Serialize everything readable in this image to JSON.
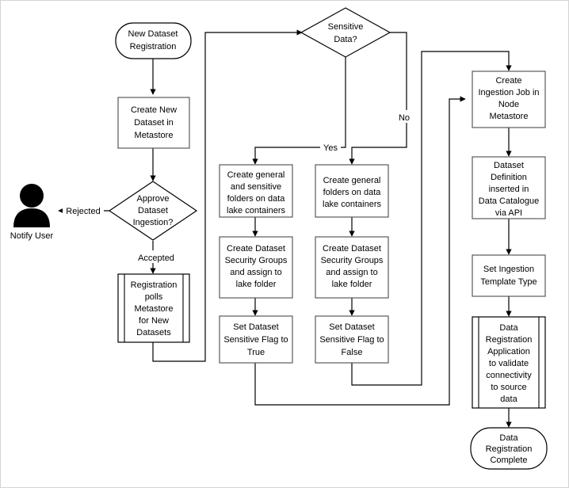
{
  "diagram": {
    "title": "Dataset Registration Flowchart",
    "type": "flowchart",
    "background": "#ffffff",
    "border_color": "#d4d4d4",
    "node_stroke": "#595959",
    "edge_color": "#595959"
  },
  "nodes": {
    "start": {
      "label": "New Dataset\nRegistration",
      "line1": "New Dataset",
      "line2": "Registration",
      "shape": "terminator"
    },
    "create_new_dataset": {
      "line1": "Create New",
      "line2": "Dataset in",
      "line3": "Metastore",
      "shape": "process"
    },
    "approve_decision": {
      "line1": "Approve",
      "line2": "Dataset",
      "line3": "Ingestion?",
      "shape": "decision"
    },
    "notify_user": {
      "label": "Notify User",
      "shape": "actor-icon"
    },
    "registration_polls": {
      "line1": "Registration",
      "line2": "polls",
      "line3": "Metastore",
      "line4": "for New",
      "line5": "Datasets",
      "shape": "predefined-process"
    },
    "sensitive_decision": {
      "line1": "Sensitive",
      "line2": "Data?",
      "shape": "decision"
    },
    "create_general_sensitive_folders": {
      "line1": "Create general",
      "line2": "and sensitive",
      "line3": "folders on data",
      "line4": "lake containers",
      "shape": "process"
    },
    "create_general_folders": {
      "line1": "Create general",
      "line2": "folders on data",
      "line3": "lake containers",
      "shape": "process"
    },
    "create_security_groups_sensitive": {
      "line1": "Create Dataset",
      "line2": "Security Groups",
      "line3": "and assign to",
      "line4": "lake folder",
      "shape": "process"
    },
    "create_security_groups_general": {
      "line1": "Create Dataset",
      "line2": "Security Groups",
      "line3": "and assign to",
      "line4": "lake folder",
      "shape": "process"
    },
    "set_flag_true": {
      "line1": "Set Dataset",
      "line2": "Sensitive Flag to",
      "line3": "True",
      "shape": "process"
    },
    "set_flag_false": {
      "line1": "Set Dataset",
      "line2": "Sensitive Flag to",
      "line3": "False",
      "shape": "process"
    },
    "create_ingestion_job": {
      "line1": "Create",
      "line2": "Ingestion Job in",
      "line3": "Node",
      "line4": "Metastore",
      "shape": "process"
    },
    "dataset_definition": {
      "line1": "Dataset",
      "line2": "Definition",
      "line3": "inserted in",
      "line4": "Data Catalogue",
      "line5": "via API",
      "shape": "process"
    },
    "set_ingestion_template": {
      "line1": "Set Ingestion",
      "line2": "Template Type",
      "shape": "process"
    },
    "validate_connectivity": {
      "line1": "Data",
      "line2": "Registration",
      "line3": "Application",
      "line4": "to validate",
      "line5": "connectivity",
      "line6": "to source",
      "line7": "data",
      "shape": "predefined-process"
    },
    "end": {
      "line1": "Data",
      "line2": "Registration",
      "line3": "Complete",
      "shape": "terminator"
    }
  },
  "edge_labels": {
    "rejected": "Rejected",
    "accepted": "Accepted",
    "yes": "Yes",
    "no": "No"
  },
  "edges": [
    {
      "from": "start",
      "to": "create_new_dataset",
      "label": ""
    },
    {
      "from": "create_new_dataset",
      "to": "approve_decision",
      "label": ""
    },
    {
      "from": "approve_decision",
      "to": "notify_user",
      "label": "Rejected"
    },
    {
      "from": "approve_decision",
      "to": "registration_polls",
      "label": "Accepted"
    },
    {
      "from": "registration_polls",
      "to": "sensitive_decision",
      "label": ""
    },
    {
      "from": "sensitive_decision",
      "to": "create_general_sensitive_folders",
      "label": "Yes"
    },
    {
      "from": "sensitive_decision",
      "to": "create_general_folders",
      "label": "No"
    },
    {
      "from": "create_general_sensitive_folders",
      "to": "create_security_groups_sensitive",
      "label": ""
    },
    {
      "from": "create_security_groups_sensitive",
      "to": "set_flag_true",
      "label": ""
    },
    {
      "from": "create_general_folders",
      "to": "create_security_groups_general",
      "label": ""
    },
    {
      "from": "create_security_groups_general",
      "to": "set_flag_false",
      "label": ""
    },
    {
      "from": "set_flag_true",
      "to": "create_ingestion_job",
      "label": ""
    },
    {
      "from": "set_flag_false",
      "to": "create_ingestion_job",
      "label": ""
    },
    {
      "from": "create_ingestion_job",
      "to": "dataset_definition",
      "label": ""
    },
    {
      "from": "dataset_definition",
      "to": "set_ingestion_template",
      "label": ""
    },
    {
      "from": "set_ingestion_template",
      "to": "validate_connectivity",
      "label": ""
    },
    {
      "from": "validate_connectivity",
      "to": "end",
      "label": ""
    }
  ]
}
